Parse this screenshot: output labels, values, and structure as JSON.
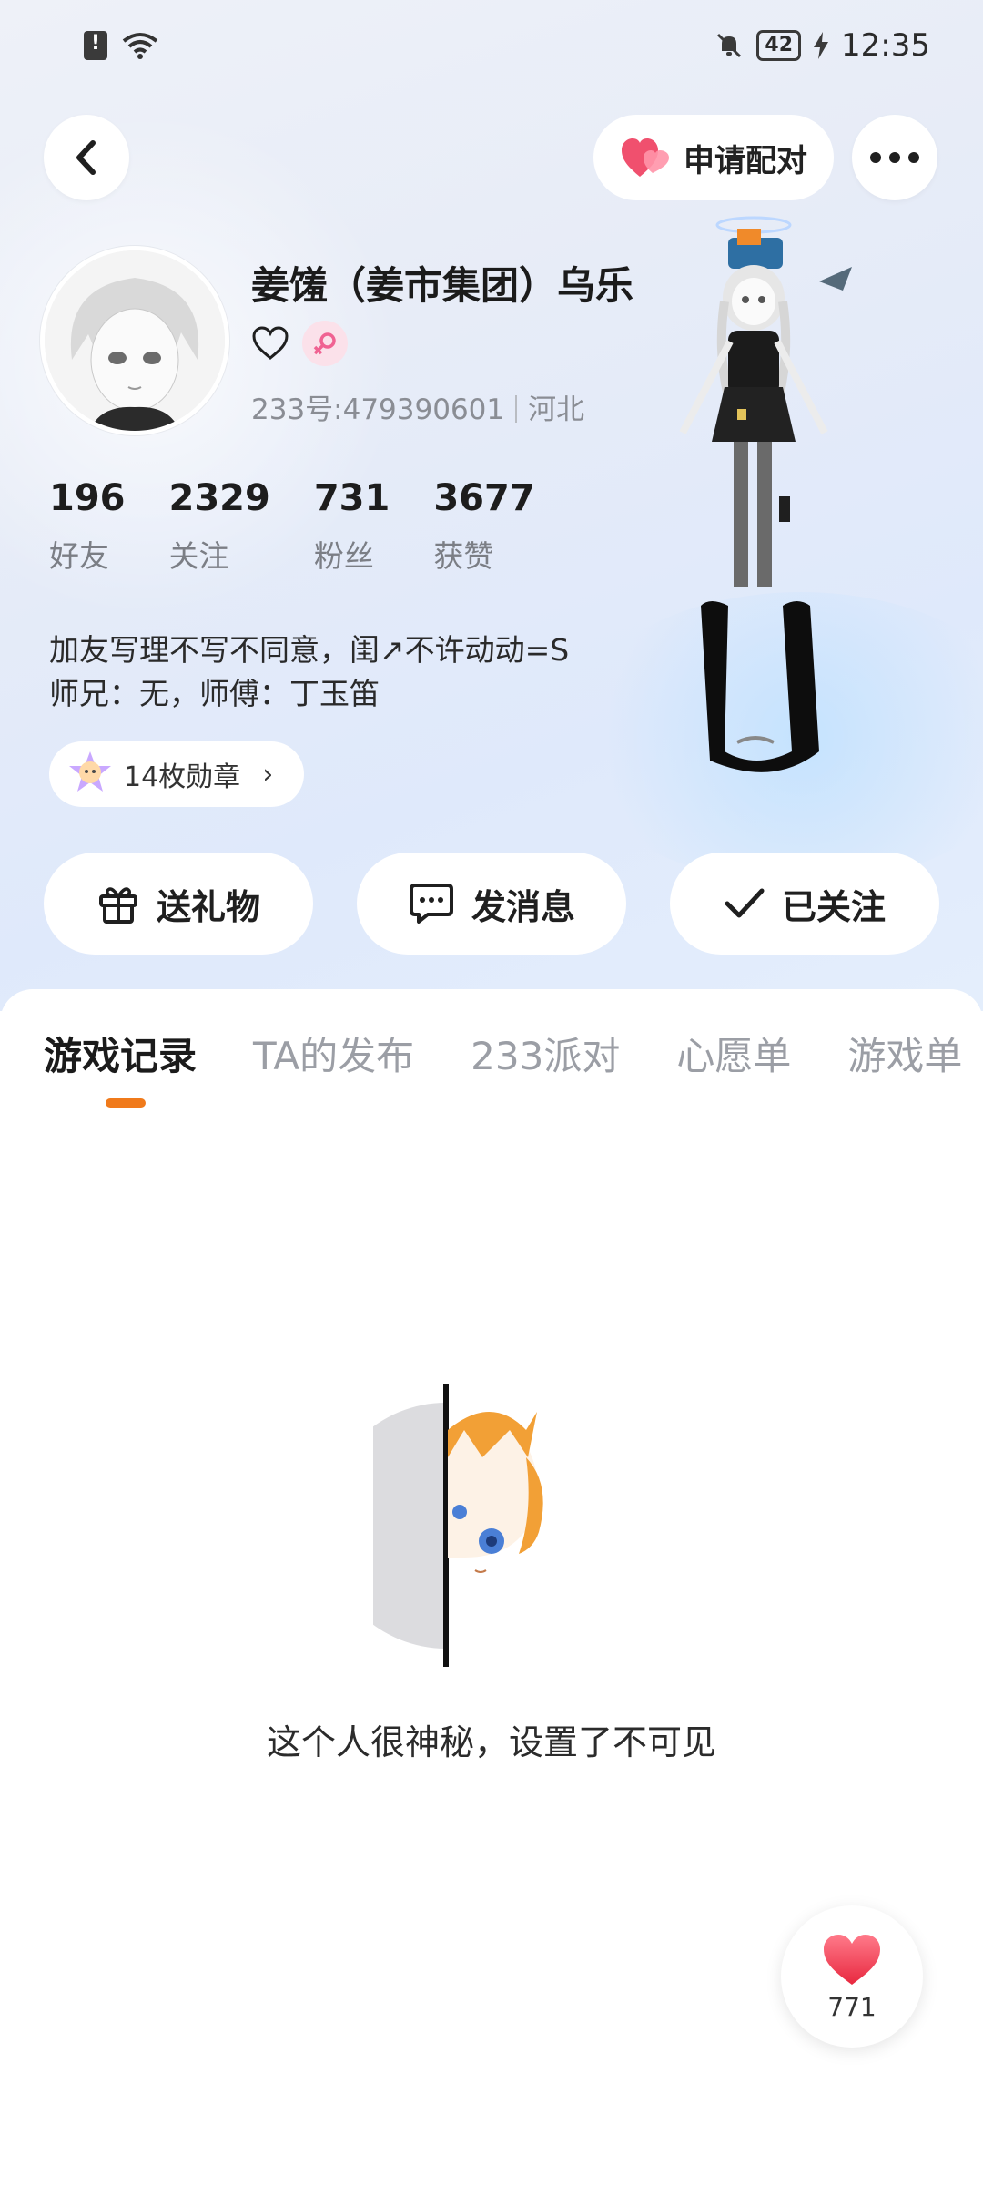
{
  "status_bar": {
    "time": "12:35",
    "battery": "42"
  },
  "header": {
    "pair_label": "申请配对"
  },
  "profile": {
    "name": "姜馐（姜市集团）乌乐",
    "id_text": "233号:479390601",
    "location": "河北",
    "stats": [
      {
        "value": "196",
        "label": "好友"
      },
      {
        "value": "2329",
        "label": "关注"
      },
      {
        "value": "731",
        "label": "粉丝"
      },
      {
        "value": "3677",
        "label": "获赞"
      }
    ],
    "bio_line1": "加友写理不写不同意，闺↗不许动动=S",
    "bio_line2": "师兄：无，师傅：丁玉笛",
    "medal_label": "14枚勋章"
  },
  "actions": {
    "gift": "送礼物",
    "message": "发消息",
    "followed": "已关注"
  },
  "tabs": [
    "游戏记录",
    "TA的发布",
    "233派对",
    "心愿单",
    "游戏单"
  ],
  "empty": {
    "text": "这个人很神秘，设置了不可见"
  },
  "like": {
    "count": "771"
  },
  "colors": {
    "accent": "#f07a1b",
    "heart": "#f0506e"
  }
}
